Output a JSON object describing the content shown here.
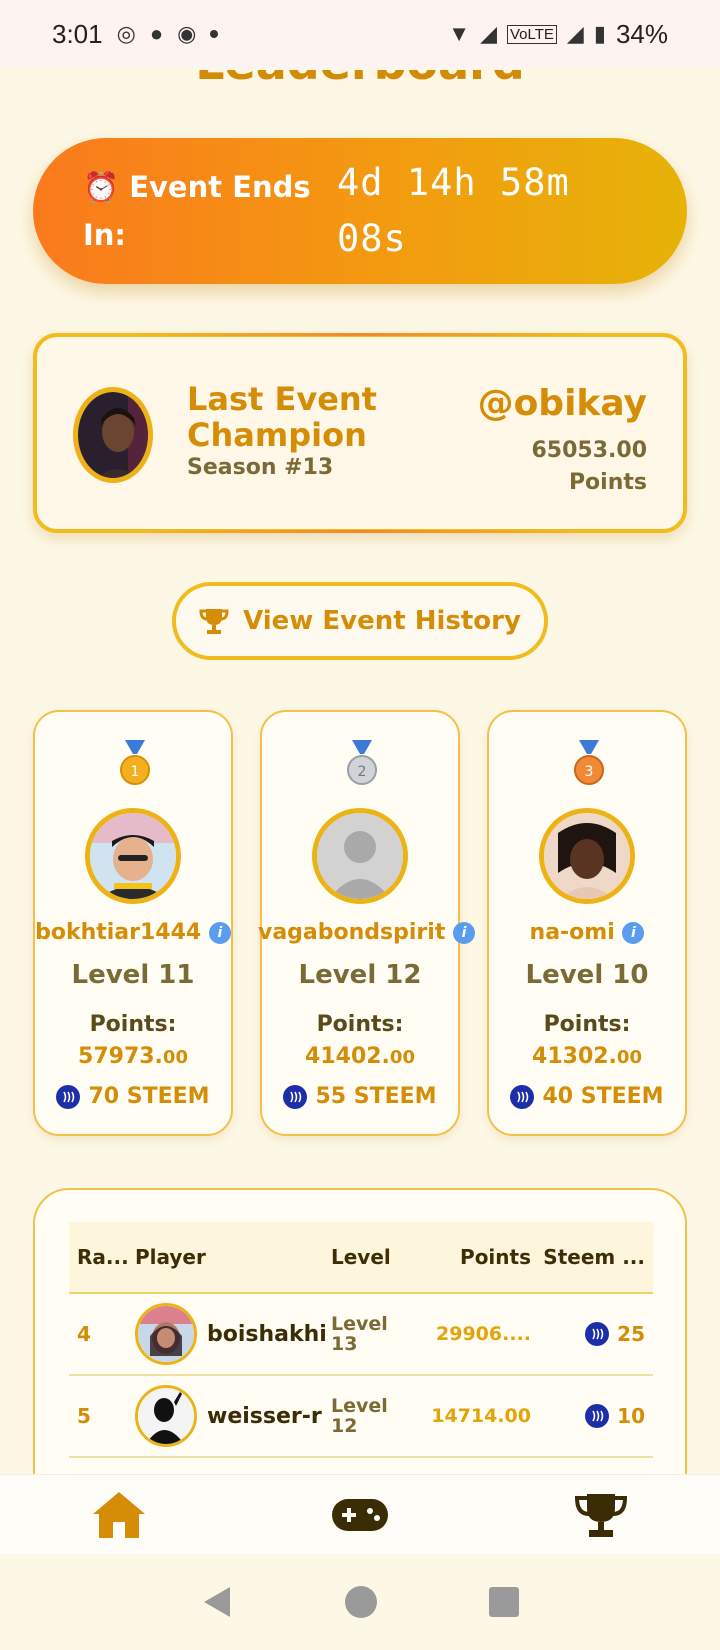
{
  "status": {
    "time": "3:01",
    "battery": "34%",
    "network": "VoLTE"
  },
  "page": {
    "title": "Leaderboard"
  },
  "timer": {
    "label": "⏰ Event Ends In:",
    "value": "4d 14h 58m 08s"
  },
  "champion": {
    "title": "Last Event Champion",
    "season": "Season #13",
    "name": "@obikay",
    "points": "65053.00",
    "points_label": "Points"
  },
  "history_button": {
    "label": "View Event History"
  },
  "podium": [
    {
      "username": "bokhtiar1444",
      "level": "Level 11",
      "points_label": "Points:",
      "points_int": "57973.",
      "points_dec": "00",
      "reward": "70 STEEM",
      "medal_number": "1"
    },
    {
      "username": "vagabondspirit",
      "level": "Level 12",
      "points_label": "Points:",
      "points_int": "41402.",
      "points_dec": "00",
      "reward": "55 STEEM",
      "medal_number": "2"
    },
    {
      "username": "na-omi",
      "level": "Level 10",
      "points_label": "Points:",
      "points_int": "41302.",
      "points_dec": "00",
      "reward": "40 STEEM",
      "medal_number": "3"
    }
  ],
  "table": {
    "headers": [
      "Ra...",
      "Player",
      "Level",
      "Points",
      "Steem ..."
    ],
    "rows": [
      {
        "rank": "4",
        "player": "boishakhi",
        "level_word": "Level",
        "level_num": "13",
        "points": "29906....",
        "steem": "25"
      },
      {
        "rank": "5",
        "player": "weisser-r",
        "level_word": "Level",
        "level_num": "12",
        "points": "14714.00",
        "steem": "10"
      }
    ]
  },
  "colors": {
    "accent": "#d58c06",
    "gradient_start": "#fa7a1d",
    "gradient_end": "#e6b308",
    "border": "#f2bb1e"
  }
}
